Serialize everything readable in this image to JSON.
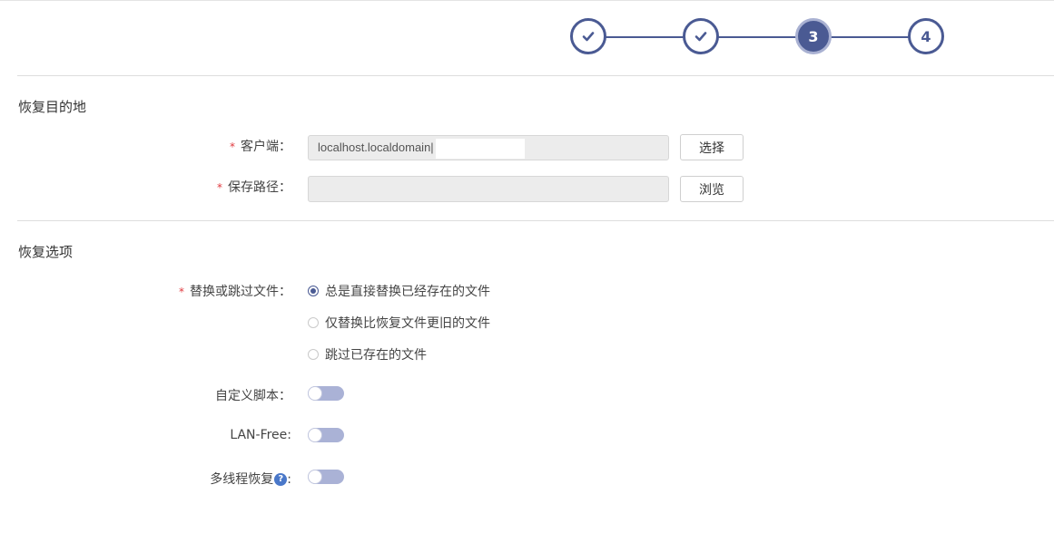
{
  "stepper": {
    "steps": [
      {
        "label": "",
        "state": "done",
        "icon": "check-icon"
      },
      {
        "label": "",
        "state": "done",
        "icon": "check-icon"
      },
      {
        "label": "3",
        "state": "current"
      },
      {
        "label": "4",
        "state": "pending"
      }
    ],
    "accent_color": "#4a5a93"
  },
  "destination": {
    "title": "恢复目的地",
    "client_label": "客户端：",
    "client_value": "localhost.localdomain|",
    "select_button": "选择",
    "path_label": "保存路径：",
    "path_value": "",
    "browse_button": "浏览"
  },
  "options": {
    "title": "恢复选项",
    "replace_label": "替换或跳过文件：",
    "radio_options": [
      {
        "label": "总是直接替换已经存在的文件",
        "checked": true
      },
      {
        "label": "仅替换比恢复文件更旧的文件",
        "checked": false
      },
      {
        "label": "跳过已存在的文件",
        "checked": false
      }
    ],
    "custom_script_label": "自定义脚本：",
    "custom_script_on": false,
    "lan_free_label": "LAN-Free:",
    "lan_free_on": false,
    "multithread_label": "多线程恢复",
    "multithread_suffix": ":",
    "multithread_on": false,
    "help_icon": "question-icon",
    "help_glyph": "?"
  },
  "required_mark": "*"
}
